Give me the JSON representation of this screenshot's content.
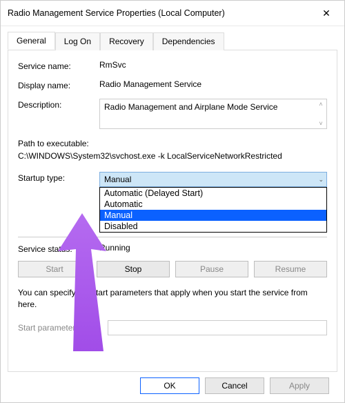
{
  "window": {
    "title": "Radio Management Service Properties (Local Computer)"
  },
  "tabs": [
    {
      "label": "General"
    },
    {
      "label": "Log On"
    },
    {
      "label": "Recovery"
    },
    {
      "label": "Dependencies"
    }
  ],
  "labels": {
    "service_name": "Service name:",
    "display_name": "Display name:",
    "description": "Description:",
    "path_to_exe": "Path to executable:",
    "startup_type": "Startup type:",
    "service_status": "Service status:",
    "start_params": "Start parameters:"
  },
  "values": {
    "service_name": "RmSvc",
    "display_name": "Radio Management Service",
    "description": "Radio Management and Airplane Mode Service",
    "exe_path": "C:\\WINDOWS\\System32\\svchost.exe -k LocalServiceNetworkRestricted",
    "status": "Running"
  },
  "startup": {
    "current": "Manual",
    "options": [
      "Automatic (Delayed Start)",
      "Automatic",
      "Manual",
      "Disabled"
    ]
  },
  "buttons": {
    "start": "Start",
    "stop": "Stop",
    "pause": "Pause",
    "resume": "Resume"
  },
  "note_text": "You can specify the start parameters that apply when you start the service from here.",
  "dialog_buttons": {
    "ok": "OK",
    "cancel": "Cancel",
    "apply": "Apply"
  }
}
